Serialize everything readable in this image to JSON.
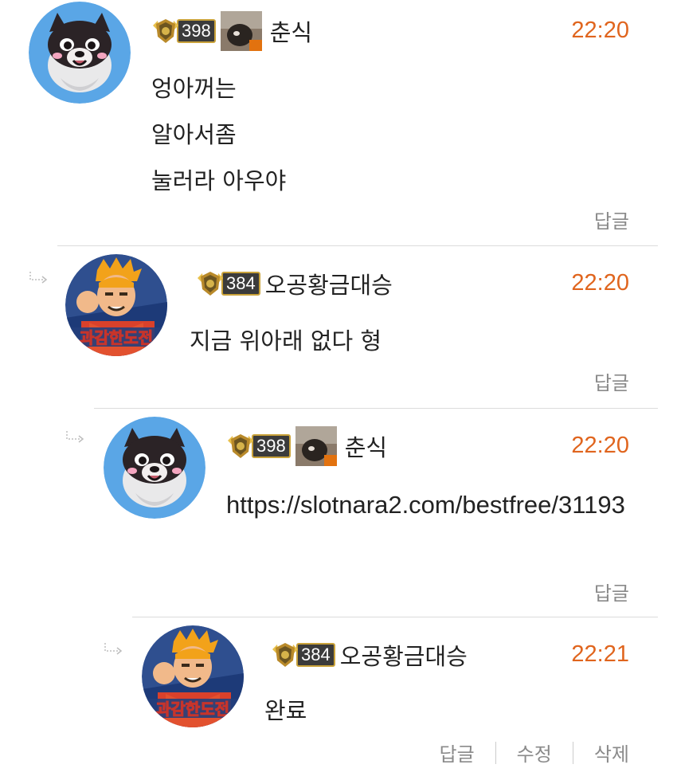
{
  "colors": {
    "time": "#e0651e",
    "action_text": "#8a8a8a",
    "divider": "#dcdcdc"
  },
  "comments": [
    {
      "level": "398",
      "user_icon": "user-photo-icon",
      "nickname": "춘식",
      "time": "22:20",
      "body": "엉아꺼는\n알아서좀\n눌러라 아우야",
      "actions": [
        "답글"
      ]
    },
    {
      "level": "384",
      "nickname": "오공황금대승",
      "time": "22:20",
      "body": "지금 위아래 없다 형",
      "actions": [
        "답글"
      ]
    },
    {
      "level": "398",
      "user_icon": "user-photo-icon",
      "nickname": "춘식",
      "time": "22:20",
      "body": "https://slotnara2.com/bestfree/31193",
      "actions": [
        "답글"
      ]
    },
    {
      "level": "384",
      "nickname": "오공황금대승",
      "time": "22:21",
      "body": "완료",
      "actions": [
        "답글",
        "수정",
        "삭제"
      ]
    }
  ]
}
